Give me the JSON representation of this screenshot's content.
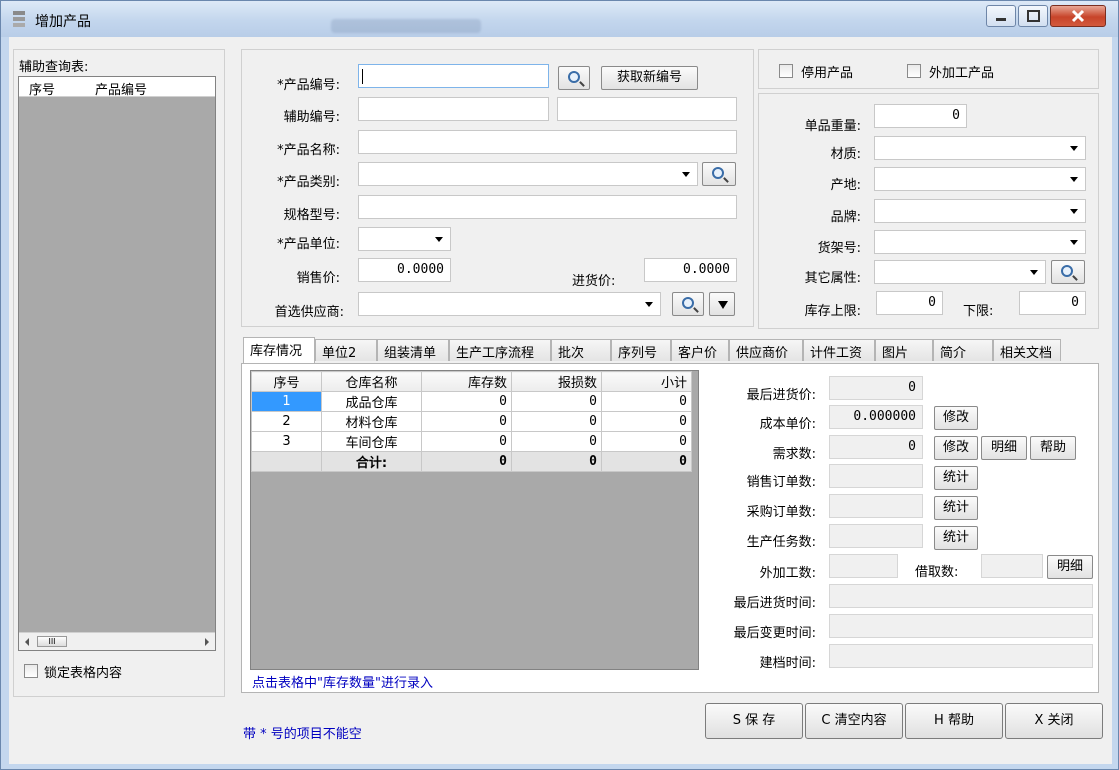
{
  "window": {
    "title": "增加产品"
  },
  "aux": {
    "title": "辅助查询表:",
    "columns": [
      "序号",
      "产品编号"
    ],
    "lock_label": "锁定表格内容",
    "scroll_thumb": "III"
  },
  "form": {
    "product_code_label": "*产品编号:",
    "get_new_code_btn": "获取新编号",
    "aux_code_label": "辅助编号:",
    "product_name_label": "*产品名称:",
    "category_label": "*产品类别:",
    "spec_label": "规格型号:",
    "unit_label": "*产品单位:",
    "sale_price_label": "销售价:",
    "sale_price_value": "0.0000",
    "purchase_price_label": "进货价:",
    "purchase_price_value": "0.0000",
    "supplier_label": "首选供应商:"
  },
  "flags": {
    "disabled_label": "停用产品",
    "outsourced_label": "外加工产品"
  },
  "attrs": {
    "weight_label": "单品重量:",
    "weight_value": "0",
    "material_label": "材质:",
    "origin_label": "产地:",
    "brand_label": "品牌:",
    "shelf_label": "货架号:",
    "other_label": "其它属性:",
    "stock_upper_label": "库存上限:",
    "stock_upper_value": "0",
    "stock_lower_label": "下限:",
    "stock_lower_value": "0"
  },
  "tabs": [
    "库存情况",
    "单位2",
    "组装清单",
    "生产工序流程",
    "批次",
    "序列号",
    "客户价",
    "供应商价",
    "计件工资",
    "图片",
    "简介",
    "相关文档"
  ],
  "stock": {
    "columns": [
      "序号",
      "仓库名称",
      "库存数",
      "报损数",
      "小计"
    ],
    "rows": [
      {
        "no": "1",
        "name": "成品仓库",
        "qty": "0",
        "loss": "0",
        "sub": "0"
      },
      {
        "no": "2",
        "name": "材料仓库",
        "qty": "0",
        "loss": "0",
        "sub": "0"
      },
      {
        "no": "3",
        "name": "车间仓库",
        "qty": "0",
        "loss": "0",
        "sub": "0"
      }
    ],
    "total": {
      "label": "合计:",
      "qty": "0",
      "loss": "0",
      "sub": "0"
    },
    "hint": "点击表格中\"库存数量\"进行录入"
  },
  "side": {
    "last_purchase_price_label": "最后进货价:",
    "last_purchase_price_value": "0",
    "unit_cost_label": "成本单价:",
    "unit_cost_value": "0.000000",
    "demand_label": "需求数:",
    "demand_value": "0",
    "sales_orders_label": "销售订单数:",
    "purchase_orders_label": "采购订单数:",
    "production_tasks_label": "生产任务数:",
    "outsourced_qty_label": "外加工数:",
    "borrowed_label": "借取数:",
    "last_purchase_time_label": "最后进货时间:",
    "last_change_time_label": "最后变更时间:",
    "created_time_label": "建档时间:",
    "modify_btn": "修改",
    "detail_btn": "明细",
    "help_btn": "帮助",
    "stat_btn": "统计"
  },
  "footer": {
    "required_note": "带 * 号的项目不能空",
    "save_btn": "S 保 存",
    "clear_btn": "C 清空内容",
    "help_btn": "H 帮助",
    "close_btn": "X 关闭"
  }
}
